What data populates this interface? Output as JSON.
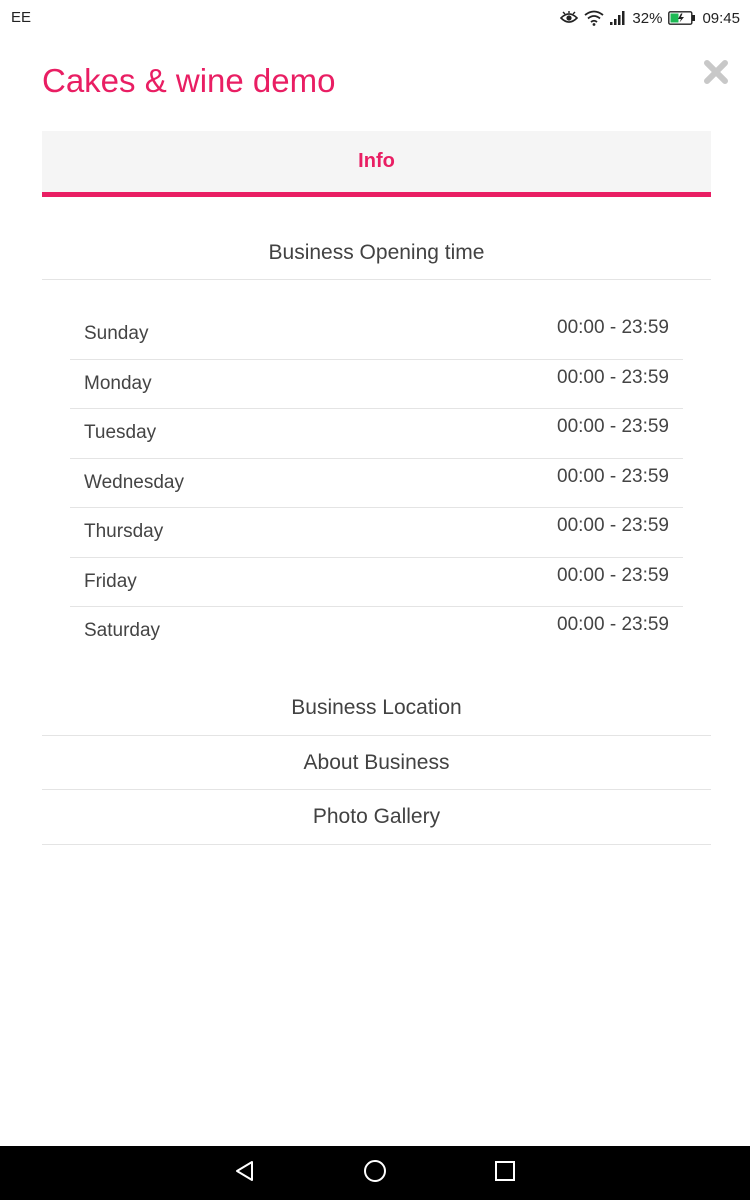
{
  "status_bar": {
    "carrier": "EE",
    "battery_percent": "32%",
    "time": "09:45"
  },
  "header": {
    "title": "Cakes & wine demo",
    "close_icon": "close-icon"
  },
  "tabs": [
    {
      "label": "Info",
      "active": true
    }
  ],
  "opening_time": {
    "heading": "Business Opening time",
    "days": [
      {
        "day": "Sunday",
        "hours": "00:00 - 23:59"
      },
      {
        "day": "Monday",
        "hours": "00:00 - 23:59"
      },
      {
        "day": "Tuesday",
        "hours": "00:00 - 23:59"
      },
      {
        "day": "Wednesday",
        "hours": "00:00 - 23:59"
      },
      {
        "day": "Thursday",
        "hours": "00:00 - 23:59"
      },
      {
        "day": "Friday",
        "hours": "00:00 - 23:59"
      },
      {
        "day": "Saturday",
        "hours": "00:00 - 23:59"
      }
    ]
  },
  "sections": {
    "location": "Business Location",
    "about": "About Business",
    "gallery": "Photo Gallery"
  },
  "colors": {
    "accent": "#e91e63",
    "tab_background": "#f5f5f5",
    "divider": "#e4e4e4",
    "nav_bar": "#000000"
  },
  "nav": {
    "back_icon": "back-triangle-icon",
    "home_icon": "home-circle-icon",
    "recent_icon": "recent-apps-square-icon"
  }
}
